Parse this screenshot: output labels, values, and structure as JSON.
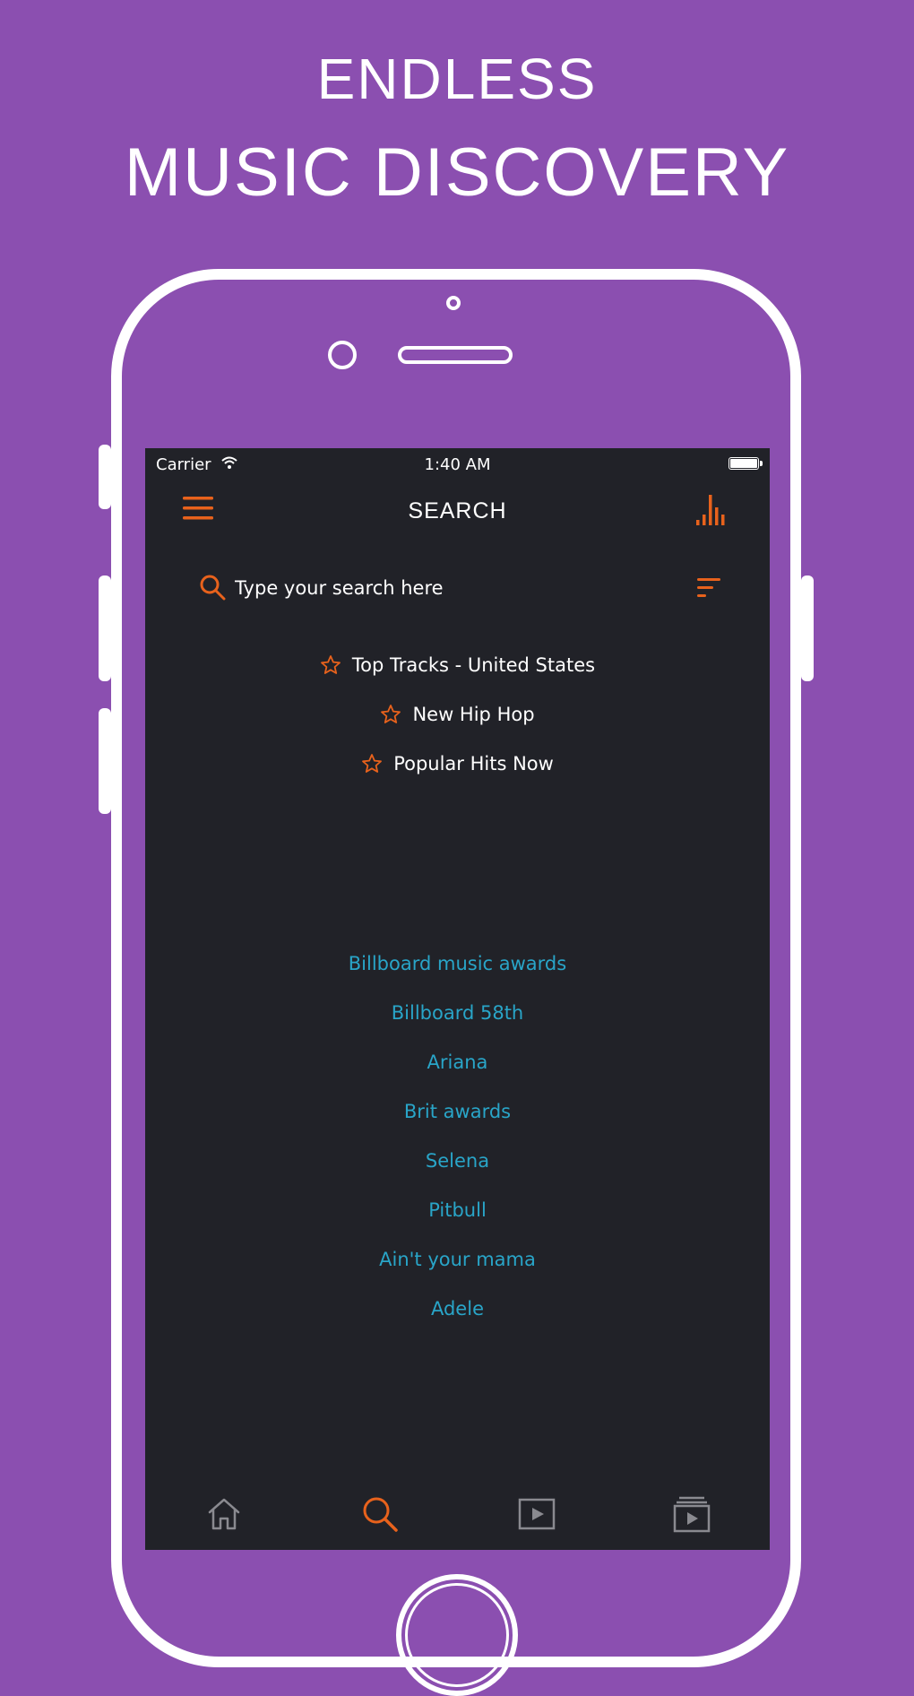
{
  "promo": {
    "line1": "ENDLESS",
    "line2": "MUSIC DISCOVERY"
  },
  "colors": {
    "background": "#8b4fb0",
    "screen": "#212228",
    "accent": "#e8621c",
    "link": "#29a5c8"
  },
  "statusbar": {
    "carrier": "Carrier",
    "time": "1:40 AM"
  },
  "navbar": {
    "title": "SEARCH",
    "left_icon": "menu-icon",
    "right_icon": "equalizer-icon"
  },
  "search": {
    "placeholder": "Type your search here",
    "value": "",
    "left_icon": "search-icon",
    "right_icon": "filter-icon"
  },
  "favorites": [
    {
      "label": "Top Tracks - United States",
      "icon": "star-icon"
    },
    {
      "label": "New Hip Hop",
      "icon": "star-icon"
    },
    {
      "label": "Popular Hits Now",
      "icon": "star-icon"
    }
  ],
  "trending": [
    "Billboard music awards",
    "Billboard 58th",
    "Ariana",
    "Brit awards",
    "Selena",
    "Pitbull",
    "Ain't your mama",
    "Adele"
  ],
  "tabs": [
    {
      "icon": "home-icon",
      "active": false
    },
    {
      "icon": "search-icon",
      "active": true
    },
    {
      "icon": "video-icon",
      "active": false
    },
    {
      "icon": "playlist-icon",
      "active": false
    }
  ]
}
